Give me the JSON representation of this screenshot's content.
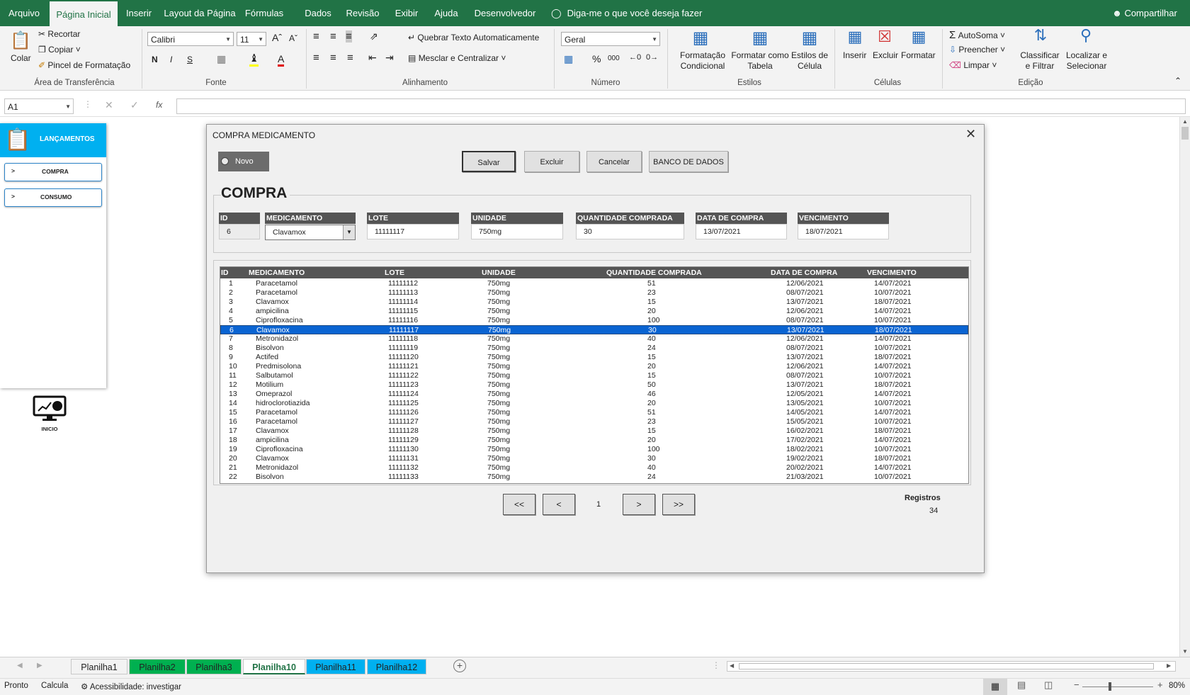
{
  "ribbon_tabs": [
    "Arquivo",
    "Página Inicial",
    "Inserir",
    "Layout da Página",
    "Fórmulas",
    "Dados",
    "Revisão",
    "Exibir",
    "Ajuda",
    "Desenvolvedor"
  ],
  "tell_me": "Diga-me o que você deseja fazer",
  "share": "Compartilhar",
  "clipboard": {
    "paste": "Colar",
    "cut": "Recortar",
    "copy": "Copiar",
    "painter": "Pincel de Formatação",
    "label": "Área de Transferência"
  },
  "font": {
    "name": "Calibri",
    "size": "11",
    "label": "Fonte",
    "bold": "N",
    "italic": "I",
    "underline": "S"
  },
  "alignment": {
    "wrap": "Quebrar Texto Automaticamente",
    "merge": "Mesclar e Centralizar",
    "label": "Alinhamento"
  },
  "number": {
    "format": "Geral",
    "label": "Número",
    "percent": "%",
    "thousands": "000"
  },
  "styles": {
    "conditional": "Formatação Condicional",
    "as_table": "Formatar como Tabela",
    "cell_styles": "Estilos de Célula",
    "label": "Estilos"
  },
  "cells": {
    "insert": "Inserir",
    "delete": "Excluir",
    "format": "Formatar",
    "label": "Células"
  },
  "editing": {
    "autosum": "AutoSoma",
    "fill": "Preencher",
    "clear": "Limpar",
    "sort": "Classificar e Filtrar",
    "find": "Localizar e Selecionar",
    "label": "Edição"
  },
  "formula_bar": {
    "name_box": "A1",
    "fx": "fx"
  },
  "left_panel": {
    "title": "LANÇAMENTOS",
    "buttons": [
      "COMPRA",
      "CONSUMO"
    ],
    "home_label": "INICIO"
  },
  "dialog": {
    "title": "COMPRA MEDICAMENTO",
    "novo": "Novo",
    "buttons": {
      "save": "Salvar",
      "delete": "Excluir",
      "cancel": "Cancelar",
      "db": "BANCO DE DADOS"
    },
    "section": "COMPRA",
    "fields": {
      "id": {
        "label": "ID",
        "value": "6"
      },
      "medicamento": {
        "label": "MEDICAMENTO",
        "value": "Clavamox"
      },
      "lote": {
        "label": "LOTE",
        "value": "11111117"
      },
      "unidade": {
        "label": "UNIDADE",
        "value": "750mg"
      },
      "quantidade": {
        "label": "QUANTIDADE COMPRADA",
        "value": "30"
      },
      "data_compra": {
        "label": "DATA DE COMPRA",
        "value": "13/07/2021"
      },
      "vencimento": {
        "label": "VENCIMENTO",
        "value": "18/07/2021"
      }
    },
    "grid_headers": [
      "ID",
      "MEDICAMENTO",
      "LOTE",
      "UNIDADE",
      "QUANTIDADE COMPRADA",
      "DATA DE COMPRA",
      "VENCIMENTO"
    ],
    "rows": [
      [
        "1",
        "Paracetamol",
        "11111112",
        "750mg",
        "51",
        "12/06/2021",
        "14/07/2021"
      ],
      [
        "2",
        "Paracetamol",
        "11111113",
        "750mg",
        "23",
        "08/07/2021",
        "10/07/2021"
      ],
      [
        "3",
        "Clavamox",
        "11111114",
        "750mg",
        "15",
        "13/07/2021",
        "18/07/2021"
      ],
      [
        "4",
        "ampicilina",
        "11111115",
        "750mg",
        "20",
        "12/06/2021",
        "14/07/2021"
      ],
      [
        "5",
        "Ciprofloxacina",
        "11111116",
        "750mg",
        "100",
        "08/07/2021",
        "10/07/2021"
      ],
      [
        "6",
        "Clavamox",
        "11111117",
        "750mg",
        "30",
        "13/07/2021",
        "18/07/2021"
      ],
      [
        "7",
        "Metronidazol",
        "11111118",
        "750mg",
        "40",
        "12/06/2021",
        "14/07/2021"
      ],
      [
        "8",
        "Bisolvon",
        "11111119",
        "750mg",
        "24",
        "08/07/2021",
        "10/07/2021"
      ],
      [
        "9",
        "Actifed",
        "11111120",
        "750mg",
        "15",
        "13/07/2021",
        "18/07/2021"
      ],
      [
        "10",
        "Predmisolona",
        "11111121",
        "750mg",
        "20",
        "12/06/2021",
        "14/07/2021"
      ],
      [
        "11",
        "Salbutamol",
        "11111122",
        "750mg",
        "15",
        "08/07/2021",
        "10/07/2021"
      ],
      [
        "12",
        "Motilium",
        "11111123",
        "750mg",
        "50",
        "13/07/2021",
        "18/07/2021"
      ],
      [
        "13",
        "Omeprazol",
        "11111124",
        "750mg",
        "46",
        "12/05/2021",
        "14/07/2021"
      ],
      [
        "14",
        "hidroclorotiazida",
        "11111125",
        "750mg",
        "20",
        "13/05/2021",
        "10/07/2021"
      ],
      [
        "15",
        "Paracetamol",
        "11111126",
        "750mg",
        "51",
        "14/05/2021",
        "14/07/2021"
      ],
      [
        "16",
        "Paracetamol",
        "11111127",
        "750mg",
        "23",
        "15/05/2021",
        "10/07/2021"
      ],
      [
        "17",
        "Clavamox",
        "11111128",
        "750mg",
        "15",
        "16/02/2021",
        "18/07/2021"
      ],
      [
        "18",
        "ampicilina",
        "11111129",
        "750mg",
        "20",
        "17/02/2021",
        "14/07/2021"
      ],
      [
        "19",
        "Ciprofloxacina",
        "11111130",
        "750mg",
        "100",
        "18/02/2021",
        "10/07/2021"
      ],
      [
        "20",
        "Clavamox",
        "11111131",
        "750mg",
        "30",
        "19/02/2021",
        "18/07/2021"
      ],
      [
        "21",
        "Metronidazol",
        "11111132",
        "750mg",
        "40",
        "20/02/2021",
        "14/07/2021"
      ],
      [
        "22",
        "Bisolvon",
        "11111133",
        "750mg",
        "24",
        "21/03/2021",
        "10/07/2021"
      ]
    ],
    "selected_row_index": 5,
    "nav": {
      "first": "<<",
      "prev": "<",
      "page": "1",
      "next": ">",
      "last": ">>"
    },
    "registros_label": "Registros",
    "registros_value": "34"
  },
  "sheet_tabs": [
    "Planilha1",
    "Planilha2",
    "Planilha3",
    "Planilha10",
    "Planilha11",
    "Planilha12"
  ],
  "sheet_tab_colors": [
    "#f3f3f3",
    "#00b050",
    "#00b050",
    "#ffffff",
    "#00b0f0",
    "#00b0f0"
  ],
  "active_sheet": "Planilha10",
  "status": {
    "ready": "Pronto",
    "calc": "Calcula",
    "accessibility": "Acessibilidade: investigar",
    "zoom": "80%"
  }
}
